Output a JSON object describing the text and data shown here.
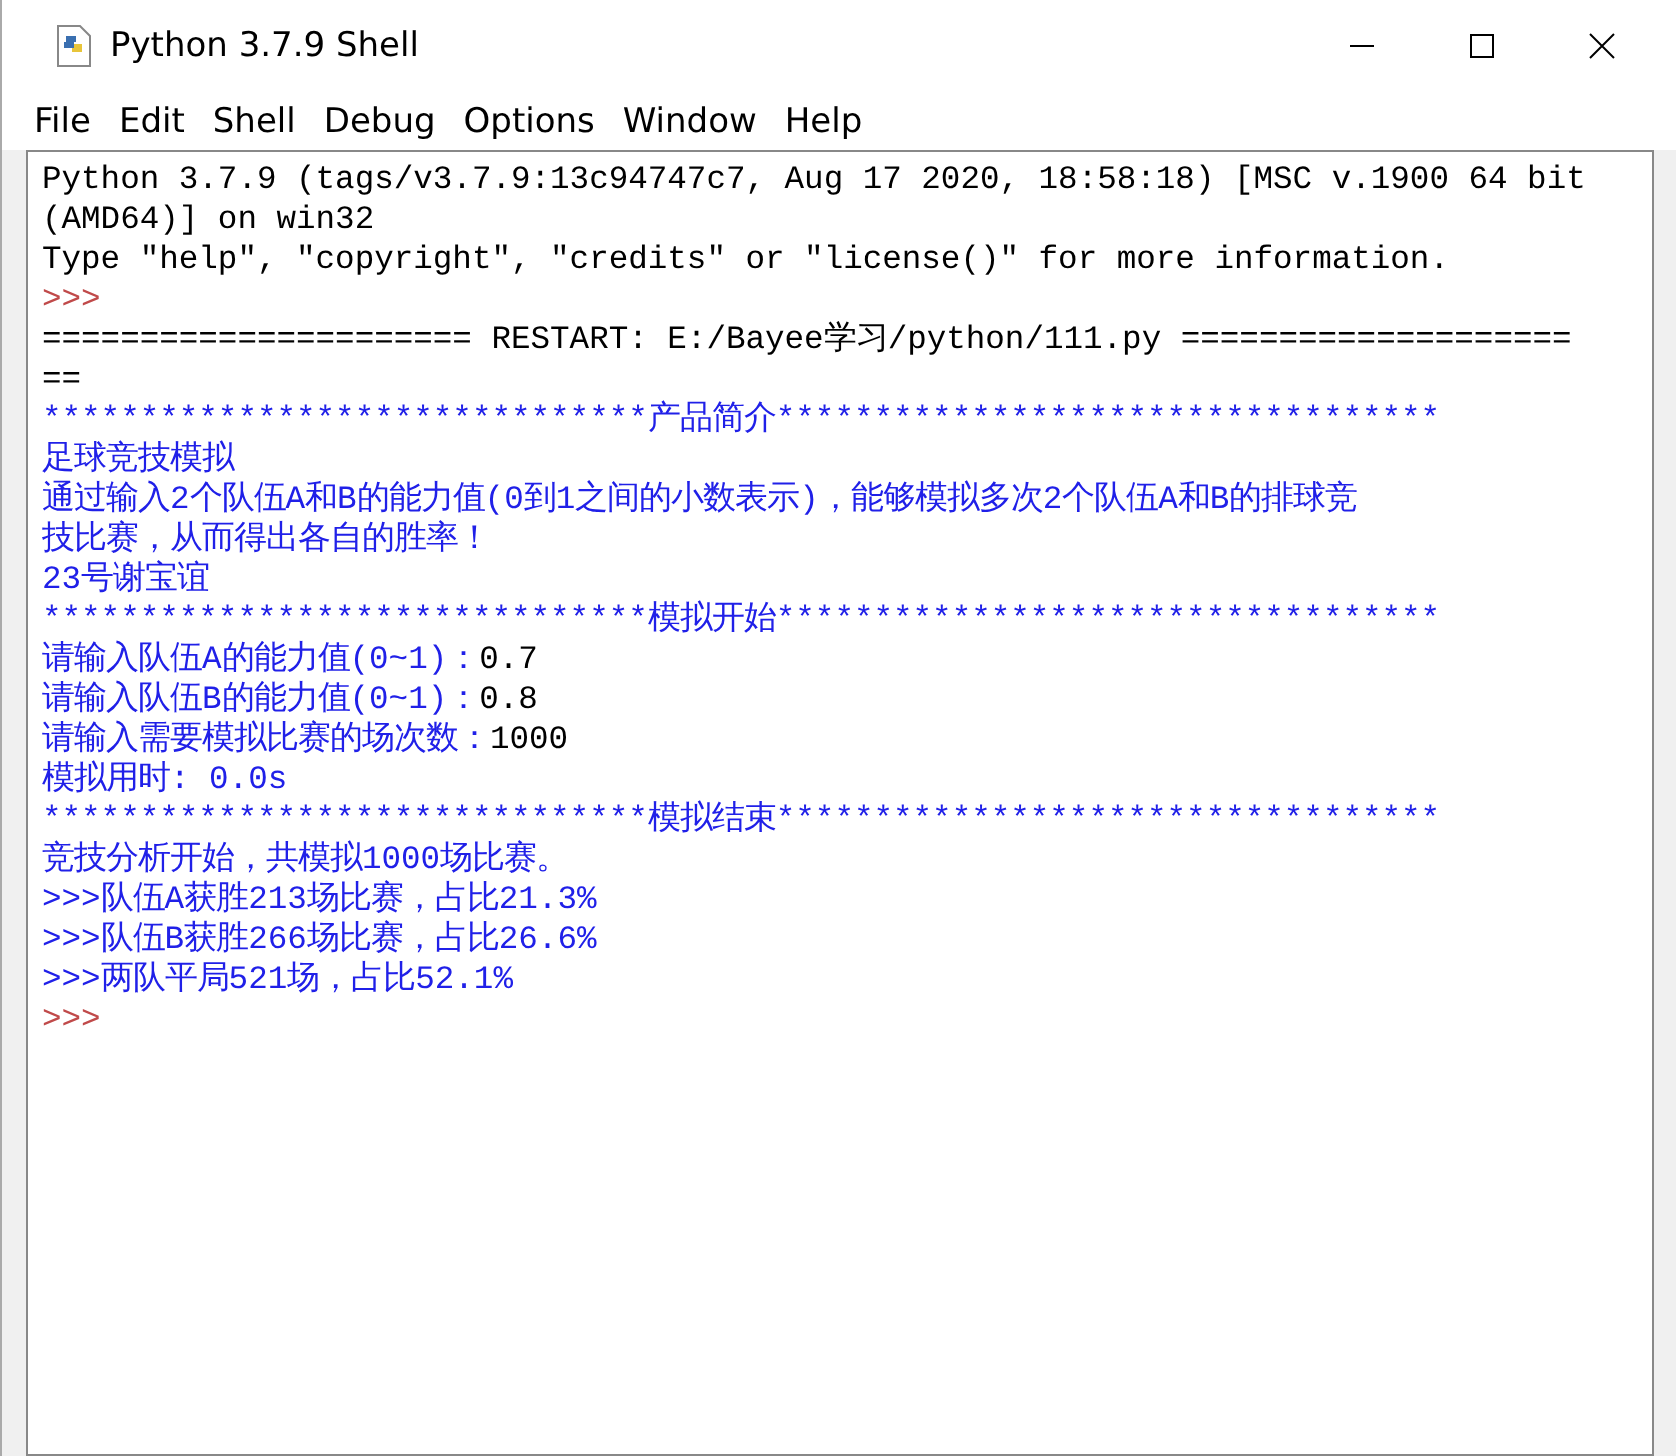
{
  "window": {
    "title": "Python 3.7.9 Shell"
  },
  "menu": [
    "File",
    "Edit",
    "Shell",
    "Debug",
    "Options",
    "Window",
    "Help"
  ],
  "lines": [
    [
      {
        "kind": "normal",
        "text": "Python 3.7.9 (tags/v3.7.9:13c94747c7, Aug 17 2020, 18:58:18) [MSC v.1900 64 bit"
      }
    ],
    [
      {
        "kind": "normal",
        "text": "(AMD64)] on win32"
      }
    ],
    [
      {
        "kind": "normal",
        "text": "Type \"help\", \"copyright\", \"credits\" or \"license()\" for more information."
      }
    ],
    [
      {
        "kind": "prompt",
        "text": ">>>"
      }
    ],
    [
      {
        "kind": "normal",
        "text": "====================== RESTART: E:/Bayee学习/python/111.py ===================="
      }
    ],
    [
      {
        "kind": "normal",
        "text": "=="
      }
    ],
    [
      {
        "kind": "stdout",
        "text": "*******************************产品简介**********************************"
      }
    ],
    [
      {
        "kind": "stdout",
        "text": "足球竞技模拟"
      }
    ],
    [
      {
        "kind": "stdout",
        "text": "通过输入2个队伍A和B的能力值(0到1之间的小数表示)，能够模拟多次2个队伍A和B的排球竞"
      }
    ],
    [
      {
        "kind": "stdout",
        "text": "技比赛，从而得出各自的胜率！"
      }
    ],
    [
      {
        "kind": "stdout",
        "text": "23号谢宝谊"
      }
    ],
    [
      {
        "kind": "stdout",
        "text": "*******************************模拟开始**********************************"
      }
    ],
    [
      {
        "kind": "stdout",
        "text": "请输入队伍A的能力值(0~1)："
      },
      {
        "kind": "normal",
        "text": "0.7"
      }
    ],
    [
      {
        "kind": "stdout",
        "text": "请输入队伍B的能力值(0~1)："
      },
      {
        "kind": "normal",
        "text": "0.8"
      }
    ],
    [
      {
        "kind": "stdout",
        "text": "请输入需要模拟比赛的场次数："
      },
      {
        "kind": "normal",
        "text": "1000"
      }
    ],
    [
      {
        "kind": "stdout",
        "text": "模拟用时: 0.0s"
      }
    ],
    [
      {
        "kind": "stdout",
        "text": "*******************************模拟结束**********************************"
      }
    ],
    [
      {
        "kind": "stdout",
        "text": "竞技分析开始，共模拟1000场比赛。"
      }
    ],
    [
      {
        "kind": "stdout",
        "text": ">>>队伍A获胜213场比赛，占比21.3%"
      }
    ],
    [
      {
        "kind": "stdout",
        "text": ">>>队伍B获胜266场比赛，占比26.6%"
      }
    ],
    [
      {
        "kind": "stdout",
        "text": ">>>两队平局521场，占比52.1%"
      }
    ],
    [
      {
        "kind": "prompt",
        "text": ">>>"
      }
    ]
  ]
}
